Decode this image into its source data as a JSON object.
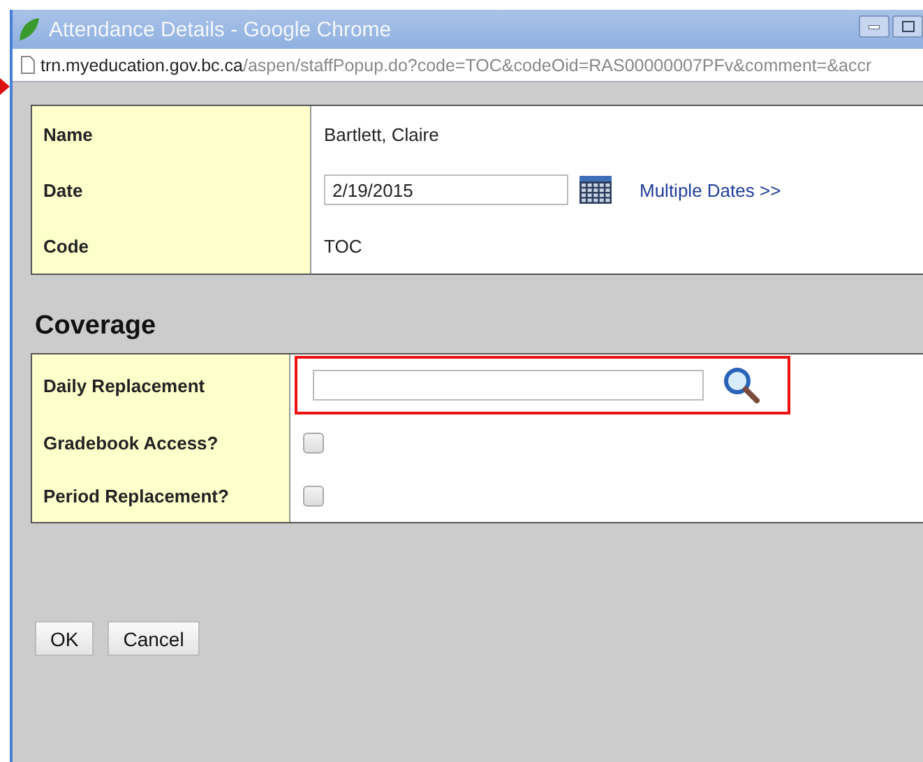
{
  "window": {
    "title": "Attendance Details - Google Chrome",
    "address_host": "trn.myeducation.gov.bc.ca",
    "address_path": "/aspen/staffPopup.do?code=TOC&codeOid=RAS00000007PFv&comment=&accr"
  },
  "details": [
    {
      "kind": "text",
      "label": "Name",
      "value": "Bartlett, Claire"
    },
    {
      "kind": "date",
      "label": "Date",
      "value": "2/19/2015",
      "link": "Multiple Dates >>"
    },
    {
      "kind": "text",
      "label": "Code",
      "value": "TOC"
    }
  ],
  "coverage": {
    "heading": "Coverage",
    "rows": [
      {
        "kind": "lookup",
        "label": "Daily Replacement",
        "value": "",
        "highlighted": true
      },
      {
        "kind": "checkbox",
        "label": "Gradebook Access?",
        "checked": false
      },
      {
        "kind": "checkbox",
        "label": "Period Replacement?",
        "checked": false
      }
    ]
  },
  "buttons": [
    "OK",
    "Cancel"
  ]
}
